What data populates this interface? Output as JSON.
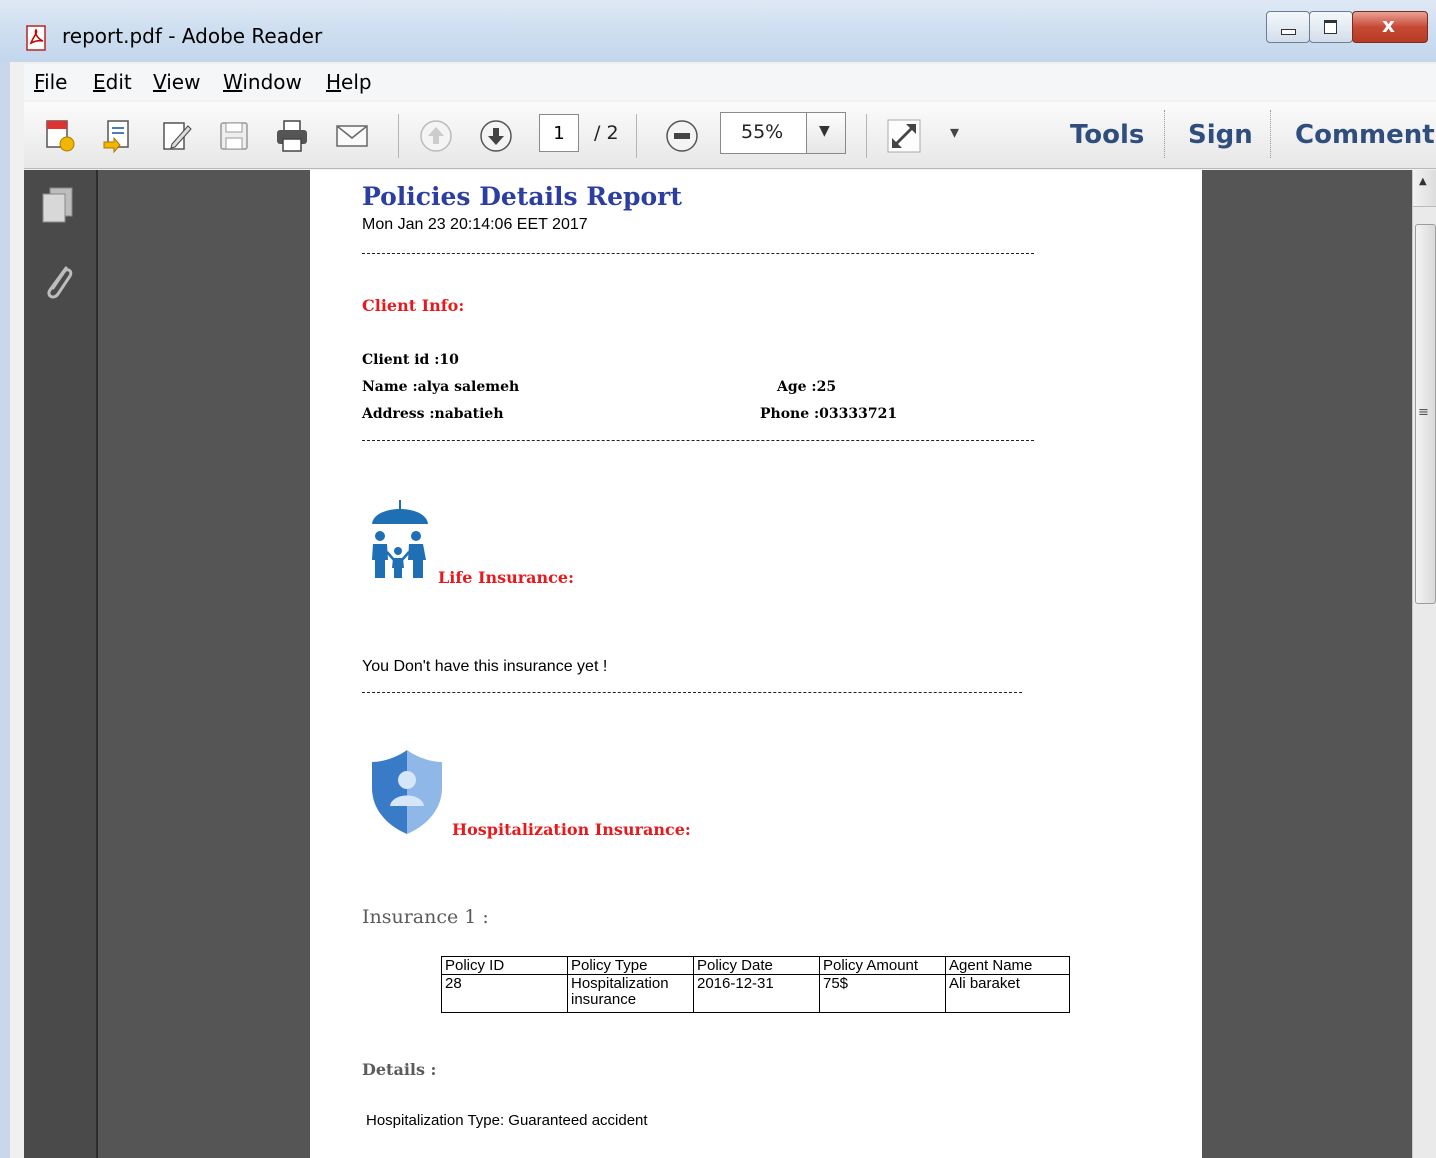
{
  "window": {
    "title": "report.pdf - Adobe Reader"
  },
  "menu": {
    "items": [
      {
        "label": "File",
        "key": "F",
        "rest": "ile"
      },
      {
        "label": "Edit",
        "key": "E",
        "rest": "dit"
      },
      {
        "label": "View",
        "key": "V",
        "rest": "iew"
      },
      {
        "label": "Window",
        "key": "W",
        "rest": "indow"
      },
      {
        "label": "Help",
        "key": "H",
        "rest": "elp"
      }
    ],
    "close_glyph": "×"
  },
  "toolbar": {
    "current_page": "1",
    "page_total": "/ 2",
    "zoom": "55%",
    "tools_label": "Tools",
    "sign_label": "Sign",
    "comment_label": "Comment"
  },
  "document": {
    "title": "Policies Details Report",
    "date": "Mon Jan 23 20:14:06 EET 2017",
    "client_info_heading": "Client Info:",
    "client_id": "Client id :10",
    "name": "Name :alya salemeh",
    "age": "Age :25",
    "address": "Address :nabatieh",
    "phone": "Phone :03333721",
    "life_heading": "Life Insurance:",
    "life_message": "You Don't have this insurance yet !",
    "hosp_heading": "Hospitalization Insurance:",
    "insurance_label": "Insurance 1 :",
    "table_headers": [
      "Policy ID",
      "Policy Type",
      "Policy Date",
      "Policy Amount",
      "Agent Name"
    ],
    "table_rows": [
      [
        "28",
        "Hospitalization insurance",
        "2016-12-31",
        "75$",
        "Ali baraket"
      ]
    ],
    "details_label": "Details :",
    "details_text": "Hospitalization Type: Guaranteed accident"
  },
  "colors": {
    "title_blue": "#2c3ea0",
    "heading_red": "#e8191d",
    "icon_blue": "#1f6fb5",
    "toolbar_text": "#2f4e7d"
  },
  "icons": [
    "pdf-app-icon",
    "create-pdf-icon",
    "open-icon",
    "edit-icon",
    "save-icon",
    "print-icon",
    "email-icon",
    "page-up-icon",
    "page-down-icon",
    "zoom-out-icon",
    "fullscreen-icon",
    "pages-panel-icon",
    "attachments-icon",
    "umbrella-family-icon",
    "shield-person-icon"
  ]
}
